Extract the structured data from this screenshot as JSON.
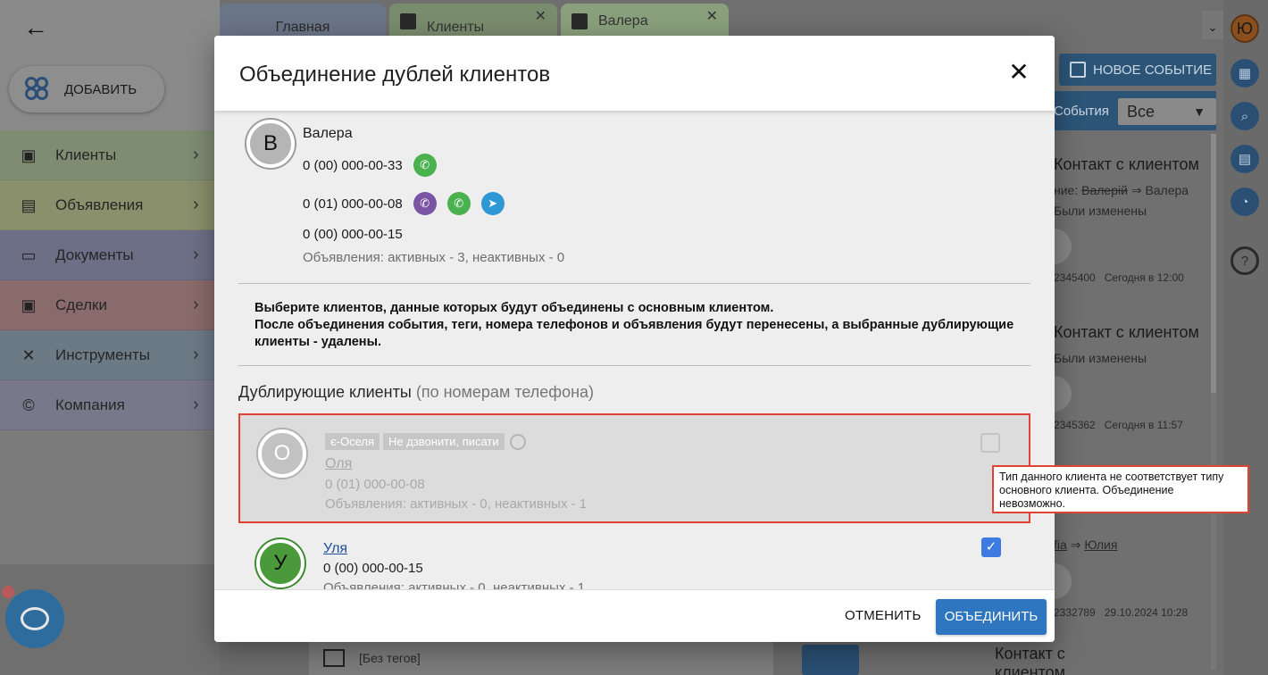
{
  "sidebar": {
    "add_label": "ДОБАВИТЬ",
    "items": [
      {
        "label": "Клиенты",
        "icon": "contacts-icon",
        "color": "#7e8c72"
      },
      {
        "label": "Объявления",
        "icon": "listing-icon",
        "color": "#8a8f6c"
      },
      {
        "label": "Документы",
        "icon": "folder-icon",
        "color": "#6d6f86"
      },
      {
        "label": "Сделки",
        "icon": "money-icon",
        "color": "#8a6b6b"
      },
      {
        "label": "Инструменты",
        "icon": "tools-icon",
        "color": "#6c7a86"
      },
      {
        "label": "Компания",
        "icon": "copyright-icon",
        "color": "#79788a"
      }
    ]
  },
  "tabs": [
    {
      "label": "Главная"
    },
    {
      "label": "Клиенты"
    },
    {
      "label": "Валера"
    }
  ],
  "right_panel": {
    "new_event_label": "НОВОЕ СОБЫТИЕ",
    "filter_label": "События",
    "filter_value": "Все",
    "cards": [
      {
        "title": "Контакт с клиентом",
        "line1_label": "ние:",
        "line1_old": "Валерій",
        "line1_arrow": "⇒",
        "line1_new": "Валера",
        "line2": "Были изменены",
        "meta_left": "2345400",
        "meta_right": "Сегодня в 12:00"
      },
      {
        "title": "Контакт с клиентом",
        "line2": "Были изменены",
        "meta_left": "2345362",
        "meta_right": "Сегодня в 11:57"
      },
      {
        "line1_old": "fia",
        "line1_arrow": "⇒",
        "line1_new": "Юлия",
        "meta_left": "2332789",
        "meta_right": "29.10.2024 10:28"
      }
    ],
    "bottom_card_title": "Контакт с клиентом"
  },
  "rail": {
    "avatar_letter": "Ю"
  },
  "bottom_strip": {
    "tags_text": "[Без тегов]"
  },
  "modal": {
    "title": "Объединение дублей клиентов",
    "main_client": {
      "avatar_letter": "В",
      "name": "Валера",
      "phones": [
        {
          "number": "0 (00) 000-00-33",
          "messengers": [
            "whatsapp"
          ]
        },
        {
          "number": "0 (01) 000-00-08",
          "messengers": [
            "viber",
            "whatsapp",
            "telegram"
          ]
        },
        {
          "number": "0 (00) 000-00-15",
          "messengers": []
        }
      ],
      "ads": "Объявления: активных - 3, неактивных - 0"
    },
    "notice_line1": "Выберите клиентов, данные которых будут объединены с основным клиентом.",
    "notice_line2": "После объединения события, теги, номера телефонов и объявления будут перенесены, а выбранные дублирующие клиенты - удалены.",
    "duplicates_heading": "Дублирующие клиенты",
    "duplicates_subheading": "(по номерам телефона)",
    "duplicates": [
      {
        "avatar_letter": "О",
        "tags": [
          "є-Оселя",
          "Не дзвонити, писати"
        ],
        "name": "Оля",
        "phone": "0 (01) 000-00-08",
        "ads": "Объявления: активных - 0, неактивных - 1",
        "checked": false,
        "disabled": true
      },
      {
        "avatar_letter": "У",
        "name": "Уля",
        "phone": "0 (00) 000-00-15",
        "ads": "Объявления: активных - 0, неактивных - 1",
        "checked": true,
        "disabled": false
      }
    ],
    "cancel_label": "ОТМЕНИТЬ",
    "merge_label": "ОБЪЕДИНИТЬ"
  },
  "tooltip": {
    "text": "Тип данного клиента не соответствует типу основного клиента. Объединение невозможно."
  },
  "colors": {
    "accent_blue": "#2f76c0",
    "highlight_red": "#e0432f",
    "whatsapp_green": "#49b24f",
    "viber_purple": "#7a55a3",
    "telegram_blue": "#2e97d6"
  }
}
